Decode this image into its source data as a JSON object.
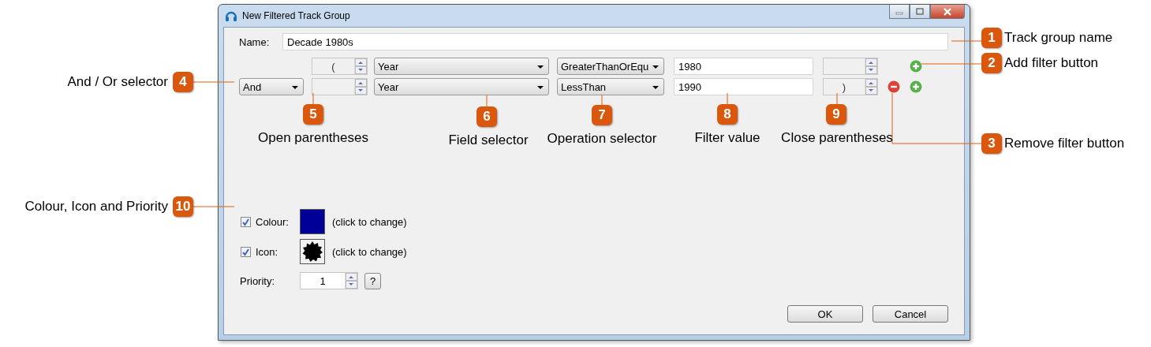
{
  "window": {
    "title": "New Filtered Track Group"
  },
  "name": {
    "label": "Name:",
    "value": "Decade 1980s"
  },
  "filters": [
    {
      "open": "(",
      "field": "Year",
      "operation": "GreaterThanOrEqu",
      "value": "1980",
      "removable": false
    },
    {
      "combinator": "And",
      "field": "Year",
      "operation": "LessThan",
      "value": "1990",
      "close": ")",
      "removable": true
    }
  ],
  "colour": {
    "label": "Colour:",
    "checked": true,
    "color": "#000099",
    "hint": "(click to change)"
  },
  "icon": {
    "label": "Icon:",
    "checked": true,
    "hint": "(click to change)"
  },
  "priority": {
    "label": "Priority:",
    "value": "1",
    "help": "?"
  },
  "buttons": [
    "OK",
    "Cancel"
  ],
  "callouts": [
    {
      "number": "1",
      "text": "Track group name"
    },
    {
      "number": "2",
      "text": "Add filter button"
    },
    {
      "number": "3",
      "text": "Remove filter button"
    },
    {
      "number": "4",
      "text": "And / Or selector"
    },
    {
      "number": "5",
      "text": "Open parentheses"
    },
    {
      "number": "6",
      "text": "Field selector"
    },
    {
      "number": "7",
      "text": "Operation selector"
    },
    {
      "number": "8",
      "text": "Filter value"
    },
    {
      "number": "9",
      "text": "Close parentheses"
    },
    {
      "number": "10",
      "text": "Colour, Icon and Priority"
    }
  ]
}
